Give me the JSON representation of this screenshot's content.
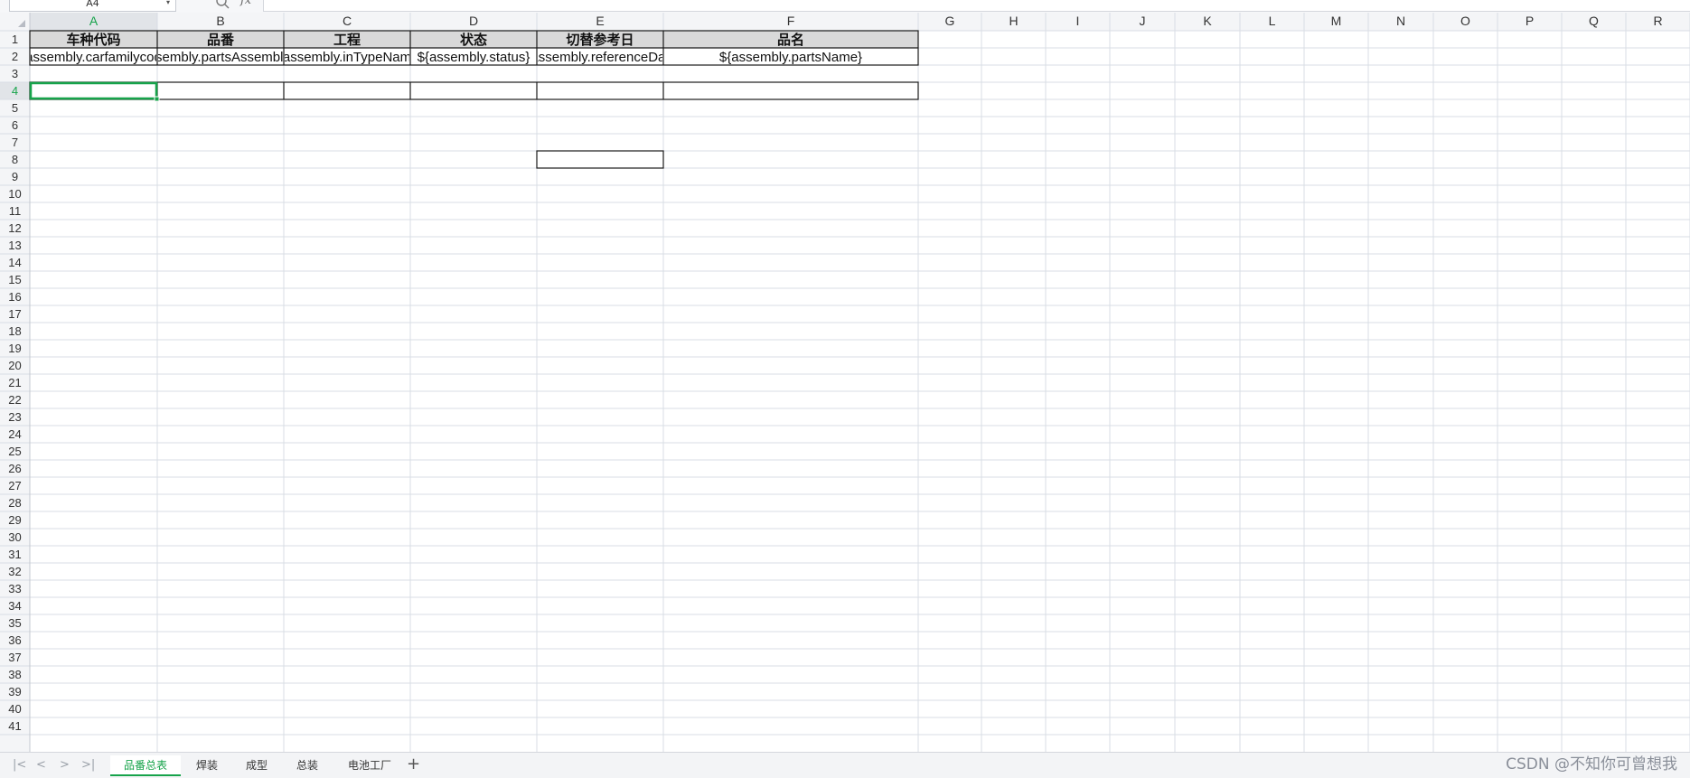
{
  "formula_bar": {
    "name_box": "A4",
    "fx_label": "fx",
    "formula": ""
  },
  "columns": [
    "A",
    "B",
    "C",
    "D",
    "E",
    "F",
    "G",
    "H",
    "I",
    "J",
    "K",
    "L",
    "M",
    "N",
    "O",
    "P",
    "Q",
    "R"
  ],
  "rows_visible": 41,
  "selected_cell": "A4",
  "header_row": {
    "A": "车种代码",
    "B": "品番",
    "C": "工程",
    "D": "状态",
    "E": "切替参考日",
    "F": "品名"
  },
  "data_row": {
    "A": "${assembly.carfamilycode}",
    "B": "${assembly.partsAssemblyNo}",
    "C": "${assembly.inTypeName}",
    "D": "${assembly.status}",
    "E": "${assembly.referenceDate}",
    "F": "${assembly.partsName}"
  },
  "sheet_tabs": {
    "nav": [
      "|<",
      "<",
      ">",
      ">|"
    ],
    "tabs": [
      "品番总表",
      "焊装",
      "成型",
      "总装",
      "电池工厂"
    ],
    "active_index": 0,
    "add_label": "+"
  },
  "watermark": "CSDN @不知你可曾想我",
  "colors": {
    "grid_line": "#d9dde4",
    "header_bg": "#f4f5f7",
    "header_row_fill": "#d9d9d9",
    "selection": "#16a34a",
    "table_border": "#1a1a1a"
  }
}
